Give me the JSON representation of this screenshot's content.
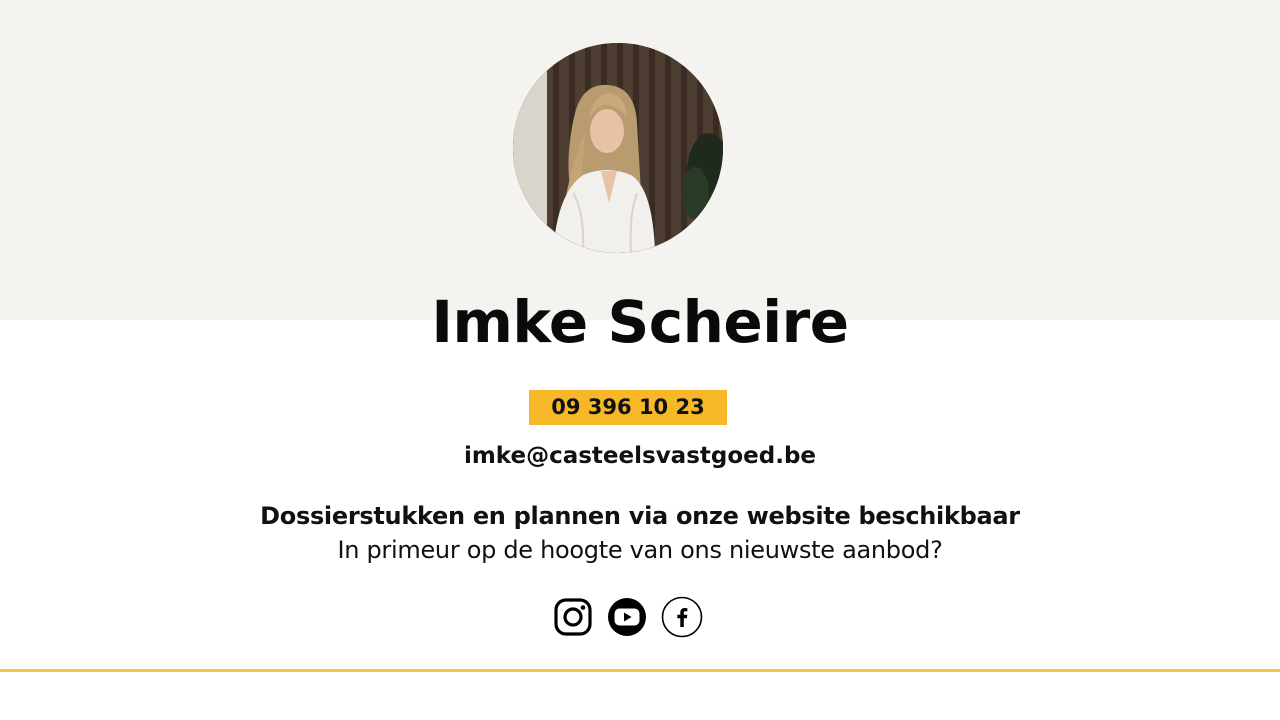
{
  "profile": {
    "name": "Imke Scheire",
    "phone": "09 396 10 23",
    "email": "imke@casteelsvastgoed.be"
  },
  "info": {
    "line_bold": "Dossierstukken en plannen via onze website beschikbaar",
    "line_regular": "In primeur op de hoogte van ons nieuwste aanbod?"
  },
  "social": [
    {
      "name": "instagram",
      "icon": "instagram-icon"
    },
    {
      "name": "youtube",
      "icon": "youtube-icon"
    },
    {
      "name": "facebook",
      "icon": "facebook-icon"
    }
  ],
  "colors": {
    "accent": "#f6b829",
    "top_band": "#f4f3ef",
    "divider": "#f1c54a",
    "text": "#0c0c0c"
  }
}
